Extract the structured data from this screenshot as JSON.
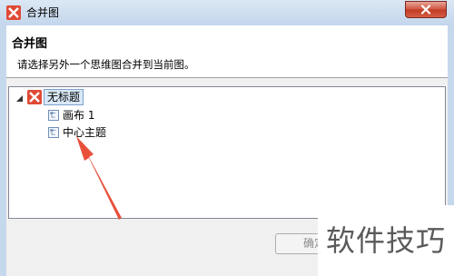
{
  "window": {
    "title": "合并图"
  },
  "header": {
    "title": "合并图",
    "description": "请选择另外一个思维图合并到当前图。"
  },
  "tree": {
    "root": {
      "label": "无标题",
      "expanded": true
    },
    "children": [
      {
        "label": "画布 1"
      },
      {
        "label": "中心主题"
      }
    ]
  },
  "buttons": {
    "ok_label": "确定"
  },
  "watermark": {
    "text": "软件技巧"
  },
  "colors": {
    "brand": "#e04a35",
    "arrow": "#e8503a",
    "selection": "#d9e8f7"
  },
  "icons": [
    "app-logo-icon",
    "close-icon",
    "expand-triangle-icon",
    "mindmap-icon",
    "sheet-icon"
  ]
}
